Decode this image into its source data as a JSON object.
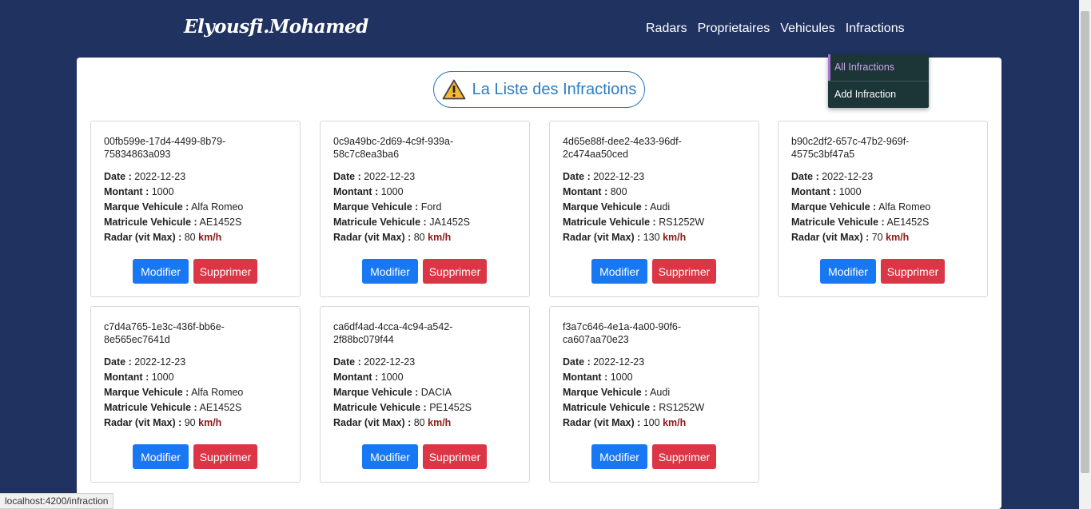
{
  "brand": "Elyousfi.Mohamed",
  "nav": [
    "Radars",
    "Proprietaires",
    "Vehicules",
    "Infractions"
  ],
  "dropdown": [
    "All Infractions",
    "Add Infraction"
  ],
  "page_title": "La Liste des Infractions",
  "labels": {
    "date": "Date :",
    "montant": "Montant :",
    "marque": "Marque Vehicule :",
    "matricule": "Matricule Vehicule :",
    "radar": "Radar (vit Max) :",
    "unit": "km/h",
    "modifier": "Modifier",
    "supprimer": "Supprimer"
  },
  "infractions": [
    {
      "id": "00fb599e-17d4-4499-8b79-75834863a093",
      "date": "2022-12-23",
      "montant": "1000",
      "marque": "Alfa Romeo",
      "matricule": "AE1452S",
      "radar": "80"
    },
    {
      "id": "0c9a49bc-2d69-4c9f-939a-58c7c8ea3ba6",
      "date": "2022-12-23",
      "montant": "1000",
      "marque": "Ford",
      "matricule": "JA1452S",
      "radar": "80"
    },
    {
      "id": "4d65e88f-dee2-4e33-96df-2c474aa50ced",
      "date": "2022-12-23",
      "montant": "800",
      "marque": "Audi",
      "matricule": "RS1252W",
      "radar": "130"
    },
    {
      "id": "b90c2df2-657c-47b2-969f-4575c3bf47a5",
      "date": "2022-12-23",
      "montant": "1000",
      "marque": "Alfa Romeo",
      "matricule": "AE1452S",
      "radar": "70"
    },
    {
      "id": "c7d4a765-1e3c-436f-bb6e-8e565ec7641d",
      "date": "2022-12-23",
      "montant": "1000",
      "marque": "Alfa Romeo",
      "matricule": "AE1452S",
      "radar": "90"
    },
    {
      "id": "ca6df4ad-4cca-4c94-a542-2f88bc079f44",
      "date": "2022-12-23",
      "montant": "1000",
      "marque": "DACIA",
      "matricule": "PE1452S",
      "radar": "80"
    },
    {
      "id": "f3a7c646-4e1a-4a00-90f6-ca607aa70e23",
      "date": "2022-12-23",
      "montant": "1000",
      "marque": "Audi",
      "matricule": "RS1252W",
      "radar": "100"
    }
  ],
  "status_url": "localhost:4200/infraction",
  "colors": {
    "navbar": "#1f3260",
    "title": "#2e7cc0",
    "modifier": "#1877f2",
    "supprimer": "#dc3545",
    "unit": "#8b1a1a"
  }
}
